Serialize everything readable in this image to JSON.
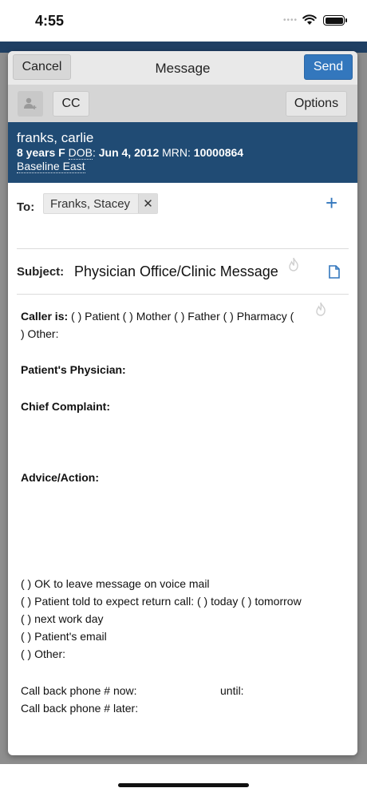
{
  "status_bar": {
    "time": "4:55",
    "signal_dots": "••••"
  },
  "header": {
    "cancel_label": "Cancel",
    "title": "Message",
    "send_label": "Send"
  },
  "toolbar": {
    "cc_label": "CC",
    "options_label": "Options"
  },
  "patient": {
    "name": "franks, carlie",
    "age_sex": "8 years F",
    "dob_label": "DOB",
    "dob_value": "Jun 4, 2012",
    "mrn_label": "MRN:",
    "mrn_value": "10000864",
    "location": "Baseline East"
  },
  "recipients": {
    "to_label": "To:",
    "chip_name": "Franks, Stacey",
    "chip_remove": "✕",
    "add_icon": "+"
  },
  "subject": {
    "label": "Subject:",
    "value": "Physician Office/Clinic Message"
  },
  "body": {
    "caller_label": "Caller is:",
    "caller_options": "( ) Patient   ( ) Mother   ( ) Father   ( ) Pharmacy   (",
    "caller_other": ") Other:",
    "physician_label": "Patient's Physician:",
    "complaint_label": "Chief Complaint:",
    "advice_label": "Advice/Action:",
    "opt1": "( ) OK to leave message on voice mail",
    "opt2": "( ) Patient told to expect return call:   ( ) today   ( ) tomorrow",
    "opt3": "( ) next work day",
    "opt4": "( ) Patient's email",
    "opt5": "( ) Other:",
    "callback_now": "Call back phone # now:",
    "until_label": "until:",
    "callback_later": "Call back phone # later:"
  },
  "colors": {
    "accent": "#3377bd",
    "patient_banner": "#204b74",
    "header_bg": "#e9e9e9",
    "toolbar_bg": "#d5d5d5"
  }
}
